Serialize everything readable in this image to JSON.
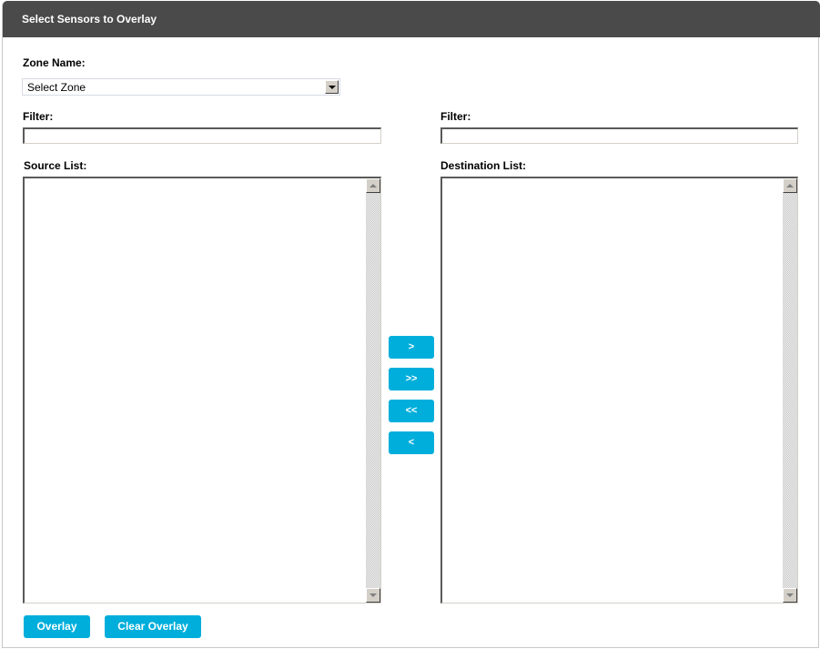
{
  "header": {
    "title": "Select Sensors to Overlay"
  },
  "zone": {
    "label": "Zone Name:",
    "selected": "Select Zone"
  },
  "source": {
    "filter_label": "Filter:",
    "filter_value": "",
    "list_label": "Source List:",
    "items": []
  },
  "destination": {
    "filter_label": "Filter:",
    "filter_value": "",
    "list_label": "Destination List:",
    "items": []
  },
  "transfer_buttons": {
    "move_selected_right": ">",
    "move_all_right": ">>",
    "move_all_left": "<<",
    "move_selected_left": "<"
  },
  "actions": {
    "overlay": "Overlay",
    "clear_overlay": "Clear Overlay"
  },
  "colors": {
    "header_bg": "#4a4a4a",
    "button_bg": "#00aedb",
    "button_text": "#ffffff"
  }
}
